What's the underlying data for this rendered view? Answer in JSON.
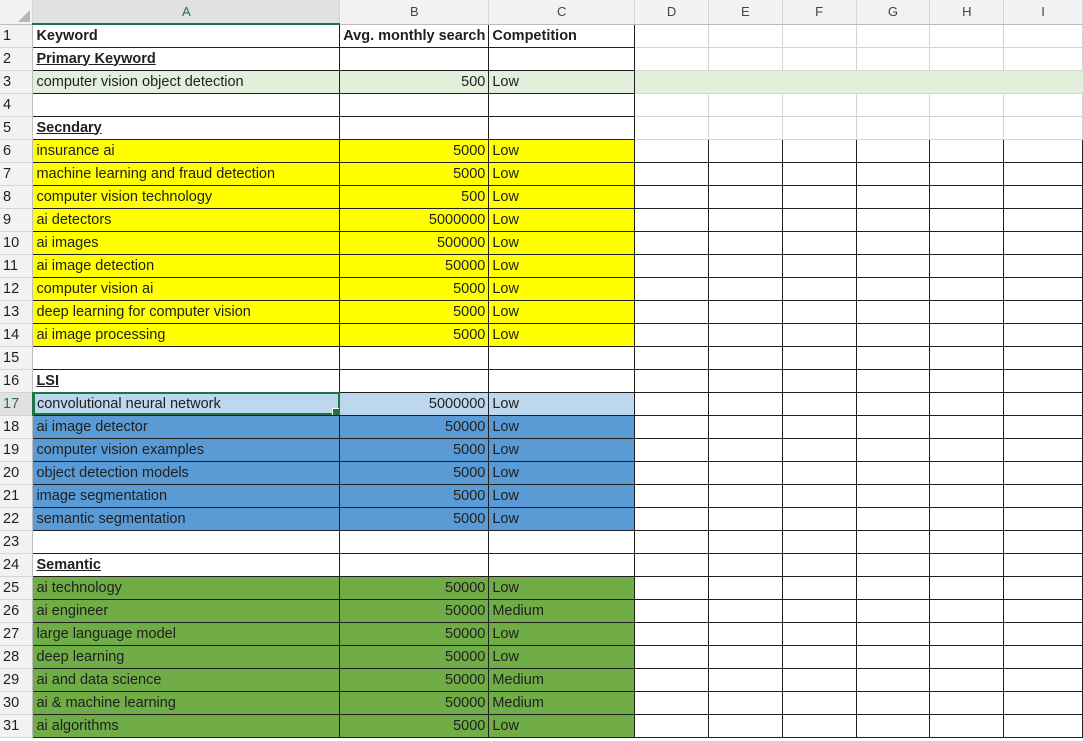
{
  "columns": [
    "A",
    "B",
    "C",
    "D",
    "E",
    "F",
    "G",
    "H",
    "I"
  ],
  "selected_column": "A",
  "active_cell": "A17",
  "headers": {
    "keyword": "Keyword",
    "avg_monthly_search": "Avg. monthly search",
    "competition": "Competition"
  },
  "sections": {
    "primary": "Primary Keyword",
    "secondary": "Secndary",
    "lsi": "LSI",
    "semantic": "Semantic"
  },
  "rows": [
    {
      "row": 1,
      "type": "header"
    },
    {
      "row": 2,
      "type": "section",
      "key": "primary"
    },
    {
      "row": 3,
      "type": "data",
      "keyword": "computer vision object detection",
      "search": "500",
      "competition": "Low",
      "fill": "green-light"
    },
    {
      "row": 4,
      "type": "blank"
    },
    {
      "row": 5,
      "type": "section",
      "key": "secondary"
    },
    {
      "row": 6,
      "type": "data",
      "keyword": "insurance ai",
      "search": "5000",
      "competition": "Low",
      "fill": "yellow"
    },
    {
      "row": 7,
      "type": "data",
      "keyword": "machine learning and fraud detection",
      "search": "5000",
      "competition": "Low",
      "fill": "yellow"
    },
    {
      "row": 8,
      "type": "data",
      "keyword": "computer vision technology",
      "search": "500",
      "competition": "Low",
      "fill": "yellow"
    },
    {
      "row": 9,
      "type": "data",
      "keyword": "ai detectors",
      "search": "5000000",
      "competition": "Low",
      "fill": "yellow"
    },
    {
      "row": 10,
      "type": "data",
      "keyword": "ai images",
      "search": "500000",
      "competition": "Low",
      "fill": "yellow"
    },
    {
      "row": 11,
      "type": "data",
      "keyword": "ai image detection",
      "search": "50000",
      "competition": "Low",
      "fill": "yellow"
    },
    {
      "row": 12,
      "type": "data",
      "keyword": "computer vision ai",
      "search": "5000",
      "competition": "Low",
      "fill": "yellow"
    },
    {
      "row": 13,
      "type": "data",
      "keyword": "deep learning for computer vision",
      "search": "5000",
      "competition": "Low",
      "fill": "yellow"
    },
    {
      "row": 14,
      "type": "data",
      "keyword": "ai image processing",
      "search": "5000",
      "competition": "Low",
      "fill": "yellow"
    },
    {
      "row": 15,
      "type": "blank"
    },
    {
      "row": 16,
      "type": "section",
      "key": "lsi"
    },
    {
      "row": 17,
      "type": "data",
      "keyword": "convolutional neural network",
      "search": "5000000",
      "competition": "Low",
      "fill": "blue-light"
    },
    {
      "row": 18,
      "type": "data",
      "keyword": "ai image detector",
      "search": "50000",
      "competition": "Low",
      "fill": "blue"
    },
    {
      "row": 19,
      "type": "data",
      "keyword": "computer vision examples",
      "search": "5000",
      "competition": "Low",
      "fill": "blue"
    },
    {
      "row": 20,
      "type": "data",
      "keyword": "object detection models",
      "search": "5000",
      "competition": "Low",
      "fill": "blue"
    },
    {
      "row": 21,
      "type": "data",
      "keyword": "image segmentation",
      "search": "5000",
      "competition": "Low",
      "fill": "blue"
    },
    {
      "row": 22,
      "type": "data",
      "keyword": "semantic segmentation",
      "search": "5000",
      "competition": "Low",
      "fill": "blue"
    },
    {
      "row": 23,
      "type": "blank"
    },
    {
      "row": 24,
      "type": "section",
      "key": "semantic"
    },
    {
      "row": 25,
      "type": "data",
      "keyword": "ai technology",
      "search": "50000",
      "competition": "Low",
      "fill": "green"
    },
    {
      "row": 26,
      "type": "data",
      "keyword": "ai engineer",
      "search": "50000",
      "competition": "Medium",
      "fill": "green"
    },
    {
      "row": 27,
      "type": "data",
      "keyword": "large language model",
      "search": "50000",
      "competition": "Low",
      "fill": "green"
    },
    {
      "row": 28,
      "type": "data",
      "keyword": "deep learning",
      "search": "50000",
      "competition": "Low",
      "fill": "green"
    },
    {
      "row": 29,
      "type": "data",
      "keyword": "ai and data science",
      "search": "50000",
      "competition": "Medium",
      "fill": "green"
    },
    {
      "row": 30,
      "type": "data",
      "keyword": "ai & machine learning",
      "search": "50000",
      "competition": "Medium",
      "fill": "green"
    },
    {
      "row": 31,
      "type": "data",
      "keyword": "ai algorithms",
      "search": "5000",
      "competition": "Low",
      "fill": "green"
    }
  ],
  "colors": {
    "green-light": "#e2efda",
    "yellow": "#ffff00",
    "blue-light": "#bdd7ee",
    "blue": "#5b9bd5",
    "green": "#70ad47",
    "selection": "#217346"
  }
}
